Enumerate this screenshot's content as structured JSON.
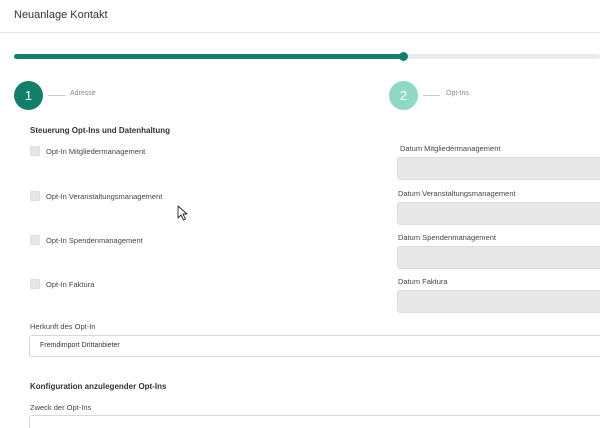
{
  "header": {
    "title": "Neuanlage Kontakt"
  },
  "progress": {
    "percent": 66.8
  },
  "steps": [
    {
      "number": "1",
      "label": "Adresse"
    },
    {
      "number": "2",
      "label": "Opt-Ins"
    }
  ],
  "optin_section": {
    "title": "Steuerung Opt-Ins und Datenhaltung",
    "checkboxes": [
      {
        "label": "Opt-In Mitgliedermanagement",
        "checked": false
      },
      {
        "label": "Opt-In Veranstaltungsmanagement",
        "checked": false
      },
      {
        "label": "Opt-In Spendenmanagement",
        "checked": false
      },
      {
        "label": "Opt-In Faktura",
        "checked": false
      }
    ],
    "dates": [
      {
        "label": "Datum Mitgliedermanagement",
        "value": ""
      },
      {
        "label": "Datum Veranstaltungsmanagement",
        "value": ""
      },
      {
        "label": "Datum Spendenmanagement",
        "value": ""
      },
      {
        "label": "Datum Faktura",
        "value": ""
      }
    ]
  },
  "herkunft": {
    "label": "Herkunft des Opt-In",
    "value": "Fremdimport Drittanbieter"
  },
  "config_section": {
    "title": "Konfiguration anzulegender Opt-Ins",
    "zweck_label": "Zweck der Opt-Ins",
    "zweck_value": ""
  },
  "colors": {
    "primary": "#137f6b",
    "primary_light": "#8fd8c6",
    "track": "#e9ebf0"
  },
  "cursor": {
    "icon": "mouse-pointer-icon"
  }
}
